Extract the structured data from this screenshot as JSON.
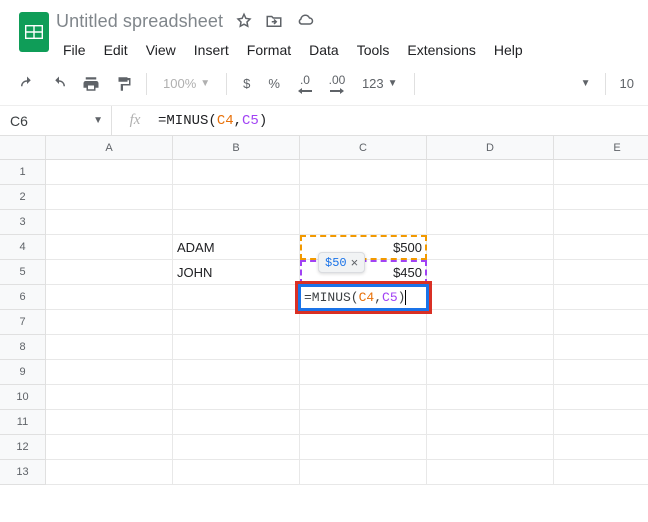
{
  "doc": {
    "title": "Untitled spreadsheet"
  },
  "menus": [
    "File",
    "Edit",
    "View",
    "Insert",
    "Format",
    "Data",
    "Tools",
    "Extensions",
    "Help"
  ],
  "toolbar": {
    "zoom": "100%",
    "currency": "$",
    "percent": "%",
    "dec_dec": ".0",
    "dec_inc": ".00",
    "numfmt": "123",
    "font_size": "10"
  },
  "formula_bar": {
    "name_box": "C6",
    "fx": "fx",
    "prefix": "=MINUS(",
    "ref1": "C4",
    "comma": ",",
    "ref2": "C5",
    "suffix": ")"
  },
  "columns": [
    "A",
    "B",
    "C",
    "D",
    "E"
  ],
  "rows": [
    "1",
    "2",
    "3",
    "4",
    "5",
    "6",
    "7",
    "8",
    "9",
    "10",
    "11",
    "12",
    "13"
  ],
  "cells": {
    "b4": "ADAM",
    "b5": "JOHN",
    "c4": "$500",
    "c5": "$450"
  },
  "hint": {
    "value": "$50"
  },
  "edit": {
    "prefix": "=MINUS(",
    "ref1": "C4",
    "comma": ",",
    "ref2": "C5",
    "suffix": ")"
  }
}
